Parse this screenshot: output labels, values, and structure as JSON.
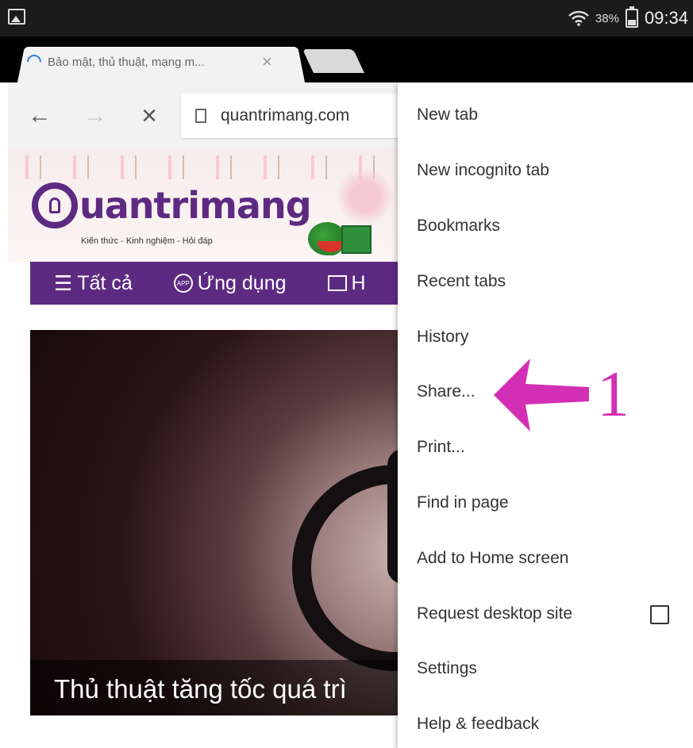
{
  "status_bar": {
    "battery": "38%",
    "time": "09:34"
  },
  "tabs": {
    "active_title": "Bảo mật, thủ thuật, mạng m...",
    "close": "×"
  },
  "toolbar": {
    "back": "←",
    "forward": "→",
    "stop": "×",
    "url": "quantrimang.com"
  },
  "site": {
    "logo_text": "uantrimang",
    "tagline": "Kiến thức - Kinh nghiệm - Hỏi đáp",
    "nav": {
      "all": "Tất cả",
      "apps": "Ứng dụng",
      "third_prefix": "H"
    },
    "app_badge": "APP",
    "hero_title": "Thủ thuật tăng tốc quá trì"
  },
  "menu": {
    "items": [
      "New tab",
      "New incognito tab",
      "Bookmarks",
      "Recent tabs",
      "History",
      "Share...",
      "Print...",
      "Find in page",
      "Add to Home screen",
      "Request desktop site",
      "Settings",
      "Help & feedback"
    ],
    "request_desktop_checked": false
  },
  "annotation": {
    "label": "1",
    "color": "#d32fb4"
  },
  "colors": {
    "brand_purple": "#5d2a82",
    "loading_blue": "#2a7de1"
  }
}
